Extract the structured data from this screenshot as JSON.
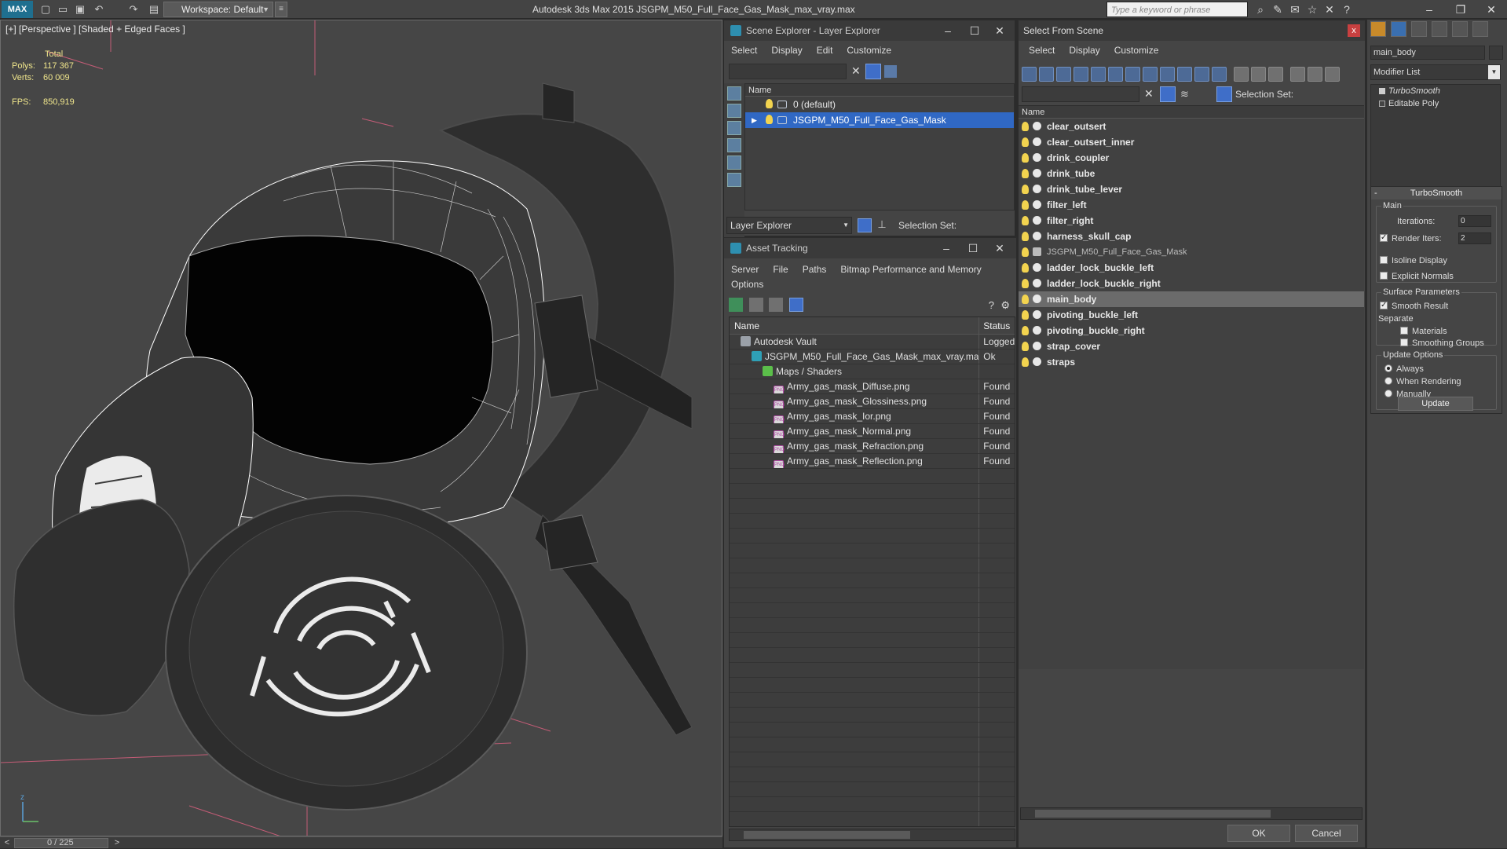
{
  "title_bar": {
    "logo": "MAX",
    "workspace": "Workspace: Default",
    "app_title": "Autodesk 3ds Max  2015    JSGPM_M50_Full_Face_Gas_Mask_max_vray.max",
    "search_placeholder": "Type a keyword or phrase"
  },
  "viewport": {
    "label": "[+] [Perspective ] [Shaded + Edged Faces ]",
    "stats": {
      "total_label": "Total",
      "polys_label": "Polys:",
      "polys_value": "117 367",
      "verts_label": "Verts:",
      "verts_value": "60 009",
      "fps_label": "FPS:",
      "fps_value": "850,919"
    },
    "axis_label": "z"
  },
  "timeline": {
    "frame": "0 / 225",
    "prev": "<",
    "next": ">"
  },
  "scene_explorer": {
    "title": "Scene Explorer - Layer Explorer",
    "menu": [
      "Select",
      "Display",
      "Edit",
      "Customize"
    ],
    "column_name": "Name",
    "layers": [
      {
        "name": "0 (default)",
        "selected": false
      },
      {
        "name": "JSGPM_M50_Full_Face_Gas_Mask",
        "selected": true
      }
    ],
    "footer_combo": "Layer Explorer",
    "selection_set_label": "Selection Set:"
  },
  "asset_tracking": {
    "title": "Asset Tracking",
    "menu": [
      "Server",
      "File",
      "Paths",
      "Bitmap Performance and Memory"
    ],
    "menu_row2": [
      "Options"
    ],
    "columns": {
      "name": "Name",
      "status": "Status"
    },
    "rows": [
      {
        "name": "Autodesk Vault",
        "status": "Logged",
        "icon": "vault-icon",
        "indent": 1
      },
      {
        "name": "JSGPM_M50_Full_Face_Gas_Mask_max_vray.max",
        "status": "Ok",
        "icon": "max-file-icon",
        "indent": 2
      },
      {
        "name": "Maps / Shaders",
        "status": "",
        "icon": "maps-icon",
        "indent": 3
      },
      {
        "name": "Army_gas_mask_Diffuse.png",
        "status": "Found",
        "icon": "png-file-icon",
        "indent": 4
      },
      {
        "name": "Army_gas_mask_Glossiness.png",
        "status": "Found",
        "icon": "png-file-icon",
        "indent": 4
      },
      {
        "name": "Army_gas_mask_Ior.png",
        "status": "Found",
        "icon": "png-file-icon",
        "indent": 4
      },
      {
        "name": "Army_gas_mask_Normal.png",
        "status": "Found",
        "icon": "png-file-icon",
        "indent": 4
      },
      {
        "name": "Army_gas_mask_Refraction.png",
        "status": "Found",
        "icon": "png-file-icon",
        "indent": 4
      },
      {
        "name": "Army_gas_mask_Reflection.png",
        "status": "Found",
        "icon": "png-file-icon",
        "indent": 4
      }
    ],
    "png_badge": "PNG"
  },
  "select_from_scene": {
    "title": "Select From Scene",
    "menu": [
      "Select",
      "Display",
      "Customize"
    ],
    "selection_set_label": "Selection Set:",
    "column_name": "Name",
    "objects": [
      {
        "name": "clear_outsert",
        "selected": false,
        "light": false
      },
      {
        "name": "clear_outsert_inner",
        "selected": false,
        "light": false
      },
      {
        "name": "drink_coupler",
        "selected": false,
        "light": false
      },
      {
        "name": "drink_tube",
        "selected": false,
        "light": false
      },
      {
        "name": "drink_tube_lever",
        "selected": false,
        "light": false
      },
      {
        "name": "filter_left",
        "selected": false,
        "light": false
      },
      {
        "name": "filter_right",
        "selected": false,
        "light": false
      },
      {
        "name": "harness_skull_cap",
        "selected": false,
        "light": false
      },
      {
        "name": "JSGPM_M50_Full_Face_Gas_Mask",
        "selected": false,
        "light": true
      },
      {
        "name": "ladder_lock_buckle_left",
        "selected": false,
        "light": false
      },
      {
        "name": "ladder_lock_buckle_right",
        "selected": false,
        "light": false
      },
      {
        "name": "main_body",
        "selected": true,
        "light": false
      },
      {
        "name": "pivoting_buckle_left",
        "selected": false,
        "light": false
      },
      {
        "name": "pivoting_buckle_right",
        "selected": false,
        "light": false
      },
      {
        "name": "strap_cover",
        "selected": false,
        "light": false
      },
      {
        "name": "straps",
        "selected": false,
        "light": false
      }
    ],
    "ok": "OK",
    "cancel": "Cancel",
    "close": "x"
  },
  "command_panel": {
    "object_name": "main_body",
    "modifier_list": "Modifier List",
    "stack": [
      "TurboSmooth",
      "Editable Poly"
    ],
    "rollout_title": "TurboSmooth",
    "main_group": "Main",
    "iterations_label": "Iterations:",
    "iterations_value": "0",
    "render_iters_label": "Render Iters:",
    "render_iters_value": "2",
    "isoline_display": "Isoline Display",
    "explicit_normals": "Explicit Normals",
    "surface_group": "Surface Parameters",
    "smooth_result": "Smooth Result",
    "separate_label": "Separate",
    "materials": "Materials",
    "smoothing_groups": "Smoothing Groups",
    "update_group": "Update Options",
    "always": "Always",
    "when_rendering": "When Rendering",
    "manually": "Manually",
    "update_button": "Update"
  },
  "colors": {
    "selection_blue": "#3068c4",
    "wire_white": "#ffffff",
    "stats_yellow": "#f0e68c",
    "grid_pink": "#e05a7a"
  }
}
